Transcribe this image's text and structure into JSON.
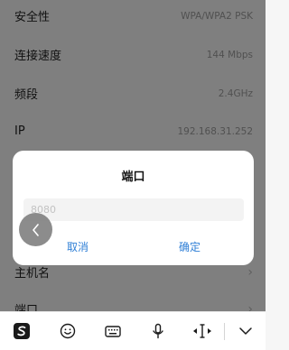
{
  "settings": {
    "rows": [
      {
        "label": "安全性",
        "value": "WPA/WPA2 PSK"
      },
      {
        "label": "连接速度",
        "value": "144 Mbps"
      },
      {
        "label": "频段",
        "value": "2.4GHz"
      },
      {
        "label": "IP",
        "value": "192.168.31.252"
      }
    ],
    "hostname_label": "主机名",
    "port_label": "端口",
    "chevron": "›"
  },
  "dialog": {
    "title": "端口",
    "input_placeholder": "8080",
    "input_value": "",
    "cancel_label": "取消",
    "confirm_label": "确定"
  },
  "icons": {
    "back": "back-arrow-icon",
    "keyboard": [
      "sogou-logo-icon",
      "emoji-icon",
      "keyboard-icon",
      "microphone-icon",
      "cursor-move-icon",
      "collapse-keyboard-icon"
    ]
  },
  "colors": {
    "accent": "#2f7fd6",
    "overlay": "rgba(0,0,0,0.48)"
  }
}
